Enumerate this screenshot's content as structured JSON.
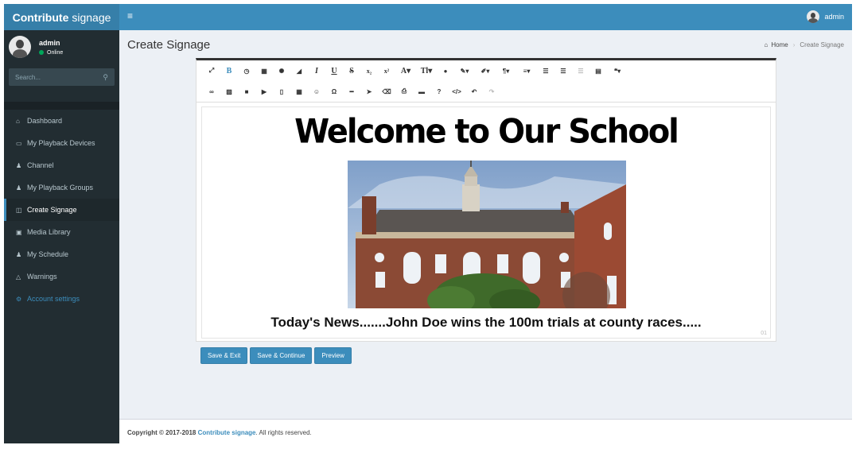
{
  "brand": {
    "name_bold": "Contribute",
    "name_light": "signage"
  },
  "user": {
    "name": "admin",
    "status": "Online"
  },
  "search": {
    "placeholder": "Search..."
  },
  "nav": [
    {
      "label": "Dashboard",
      "icon": "dashboard-icon",
      "glyph": "⌂"
    },
    {
      "label": "My Playback Devices",
      "icon": "monitor-icon",
      "glyph": "▭"
    },
    {
      "label": "Channel",
      "icon": "users-icon",
      "glyph": "♟"
    },
    {
      "label": "My Playback Groups",
      "icon": "users-icon",
      "glyph": "♟"
    },
    {
      "label": "Create Signage",
      "icon": "columns-icon",
      "glyph": "◫"
    },
    {
      "label": "Media Library",
      "icon": "image-icon",
      "glyph": "▣"
    },
    {
      "label": "My Schedule",
      "icon": "users-icon",
      "glyph": "♟"
    },
    {
      "label": "Warnings",
      "icon": "bell-icon",
      "glyph": "△"
    },
    {
      "label": "Account settings",
      "icon": "gears-icon",
      "glyph": "⚙"
    }
  ],
  "topbar": {
    "user": "admin"
  },
  "header": {
    "title": "Create Signage",
    "breadcrumb_home": "Home",
    "breadcrumb_current": "Create Signage"
  },
  "editor": {
    "heading": "Welcome to Our School",
    "news": "Today's News.......John Doe wins the 100m trials at county races.....",
    "page_number": "01"
  },
  "buttons": {
    "save_exit": "Save & Exit",
    "save_continue": "Save & Continue",
    "preview": "Preview"
  },
  "footer": {
    "prefix": "Copyright © 2017-2018",
    "brand": "Contribute signage",
    "suffix": ". All rights reserved."
  },
  "colors": {
    "topbar": "#3c8dbc",
    "sidebar": "#222d32",
    "accent": "#3c8dbc",
    "content_bg": "#ecf0f5"
  }
}
